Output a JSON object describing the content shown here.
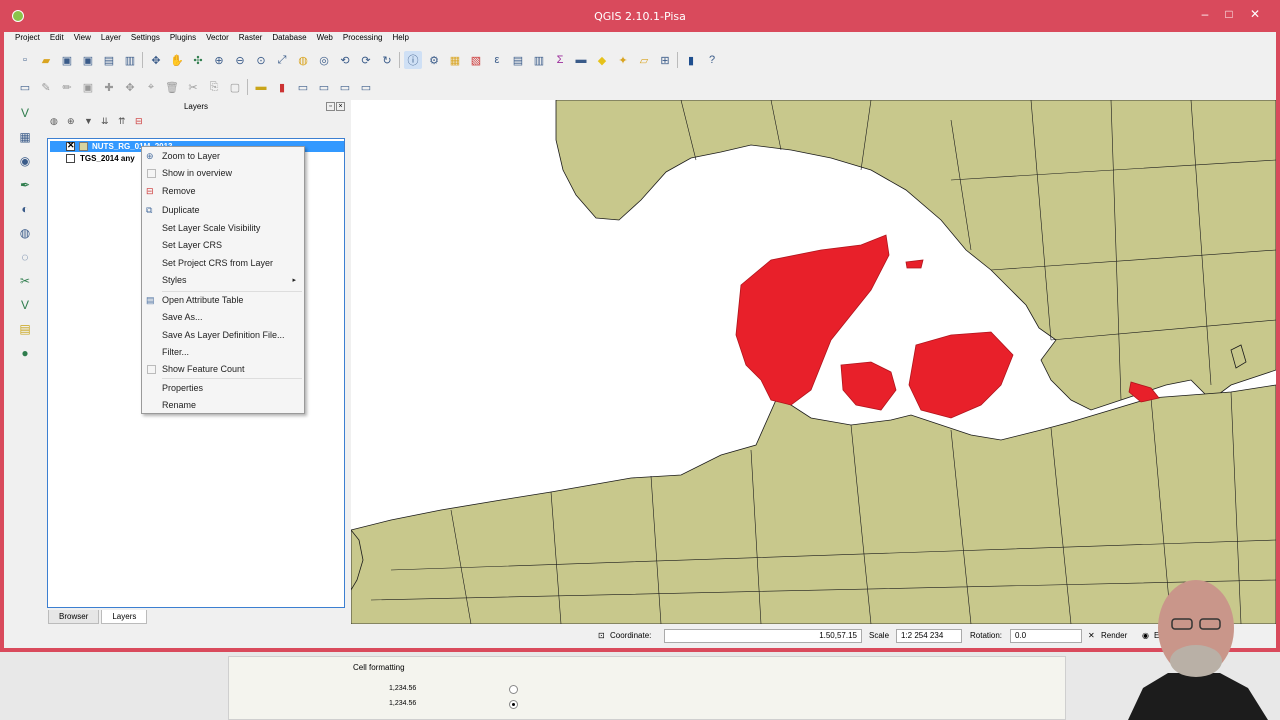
{
  "window": {
    "title": "QGIS 2.10.1-Pisa",
    "title_color": "#d94a5c",
    "controls": [
      "–",
      "□",
      "✕"
    ]
  },
  "menubar": [
    "Project",
    "Edit",
    "View",
    "Layer",
    "Settings",
    "Plugins",
    "Vector",
    "Raster",
    "Database",
    "Web",
    "Processing",
    "Help"
  ],
  "layers_panel": {
    "title": "Layers",
    "layers": [
      {
        "name": "NUTS_RG_01M_2013",
        "checked": true,
        "selected": true
      },
      {
        "name": "TGS_2014 any",
        "checked": false,
        "selected": false
      }
    ],
    "tabs": [
      "Browser",
      "Layers"
    ],
    "active_tab": "Layers"
  },
  "context_menu": {
    "items": [
      {
        "label": "Zoom to Layer",
        "icon": "zoom-icon",
        "enabled": true
      },
      {
        "label": "Show in overview",
        "icon": "checkbox-icon",
        "enabled": true
      },
      {
        "label": "Remove",
        "icon": "remove-icon",
        "enabled": true
      },
      {
        "label": "Duplicate",
        "icon": "duplicate-icon",
        "enabled": true
      },
      {
        "label": "Set Layer Scale Visibility",
        "icon": "",
        "enabled": true
      },
      {
        "label": "Set Layer CRS",
        "icon": "",
        "enabled": true
      },
      {
        "label": "Set Project CRS from Layer",
        "icon": "",
        "enabled": true
      },
      {
        "label": "Styles",
        "icon": "",
        "enabled": true,
        "submenu": true
      },
      {
        "label": "Open Attribute Table",
        "icon": "table-icon",
        "enabled": true
      },
      {
        "label": "Save As...",
        "icon": "",
        "enabled": true
      },
      {
        "label": "Save As Layer Definition File...",
        "icon": "",
        "enabled": true
      },
      {
        "label": "Filter...",
        "icon": "",
        "enabled": true
      },
      {
        "label": "Show Feature Count",
        "icon": "checkbox-icon",
        "enabled": true
      },
      {
        "label": "Properties",
        "icon": "",
        "enabled": true
      },
      {
        "label": "Rename",
        "icon": "",
        "enabled": true
      }
    ]
  },
  "map": {
    "land_color": "#c8c88c",
    "water_color": "#ffffff",
    "highlight_color": "#e8202a",
    "border_color": "#1a1a1a"
  },
  "statusbar": {
    "coordinate_label": "Coordinate:",
    "coordinate_value": "1.50,57.15",
    "scale_label": "Scale",
    "scale_value": "1:2 254 234",
    "rotation_label": "Rotation:",
    "rotation_value": "0.0",
    "render_label": "Render",
    "epsg_label": "EPSG"
  },
  "background_window": {
    "heading": "Cell formatting",
    "values": [
      "1,234.56",
      "1,234.56"
    ]
  }
}
